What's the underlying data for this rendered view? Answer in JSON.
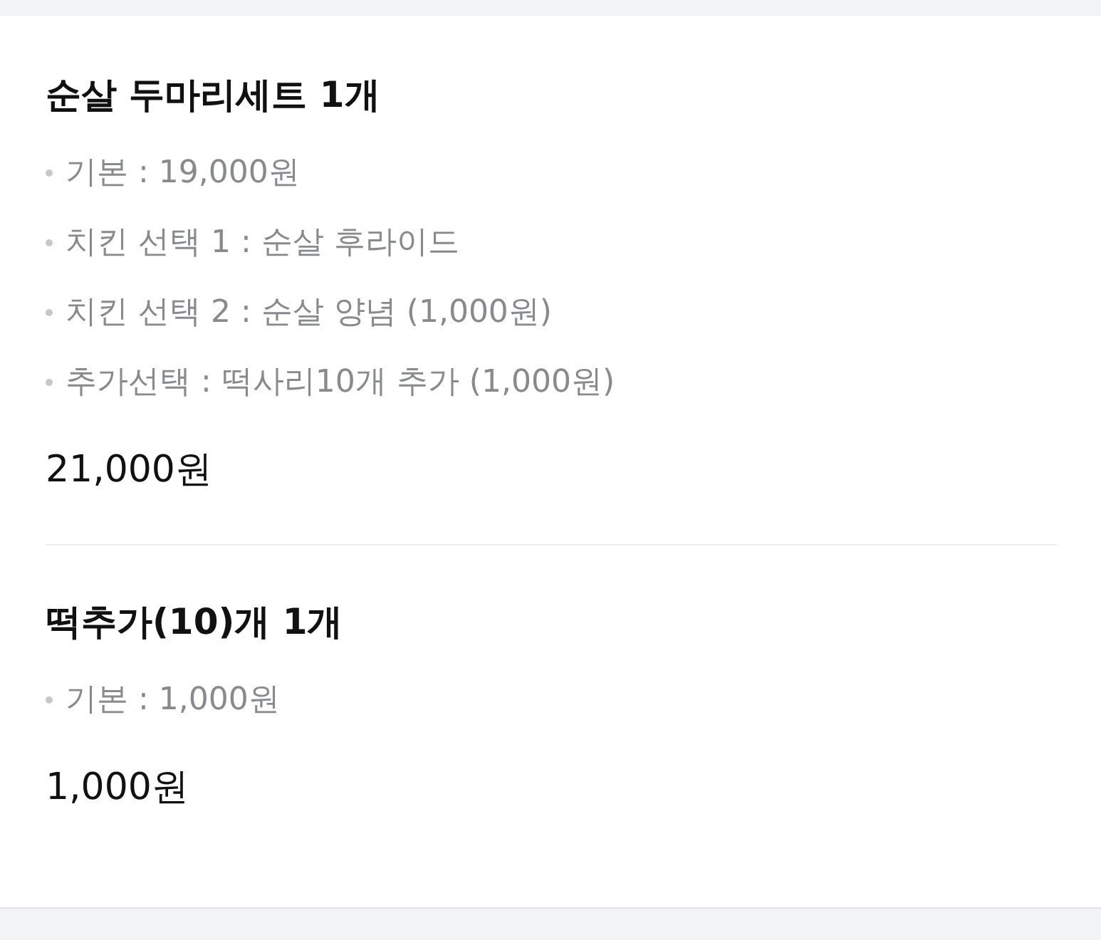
{
  "items": [
    {
      "name": "순살 두마리세트 1개",
      "options": [
        "기본 : 19,000원",
        "치킨 선택 1 : 순살 후라이드",
        "치킨 선택 2 : 순살 양념 (1,000원)",
        "추가선택 : 떡사리10개 추가 (1,000원)"
      ],
      "price": "21,000원"
    },
    {
      "name": "떡추가(10)개 1개",
      "options": [
        "기본 : 1,000원"
      ],
      "price": "1,000원"
    }
  ]
}
